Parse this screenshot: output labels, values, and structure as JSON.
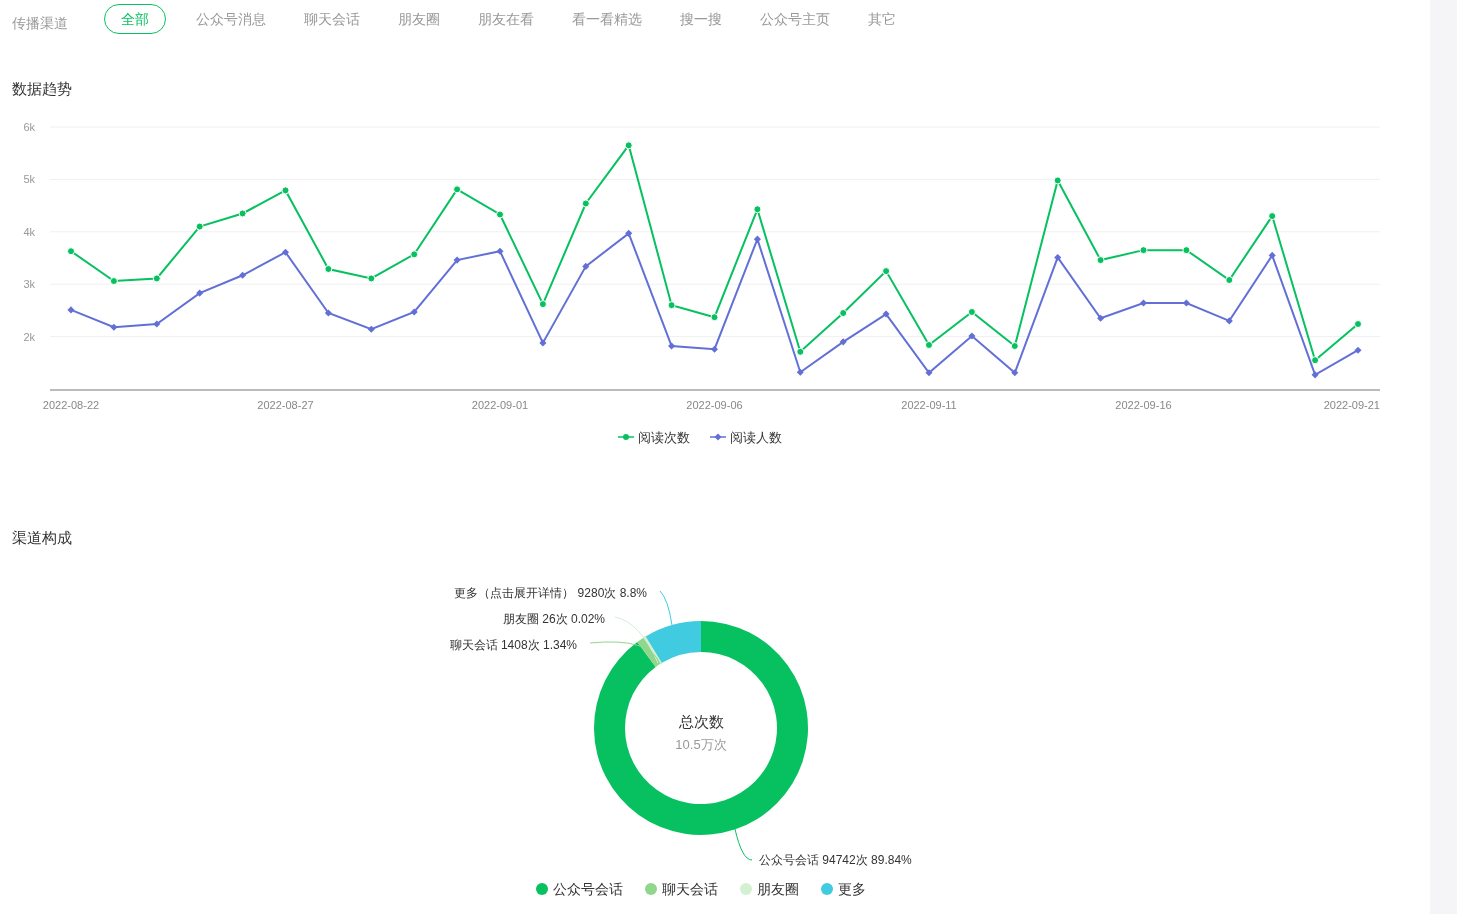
{
  "channel_filter": {
    "label": "传播渠道",
    "tabs": [
      {
        "label": "全部",
        "selected": true
      },
      {
        "label": "公众号消息",
        "selected": false
      },
      {
        "label": "聊天会话",
        "selected": false
      },
      {
        "label": "朋友圈",
        "selected": false
      },
      {
        "label": "朋友在看",
        "selected": false
      },
      {
        "label": "看一看精选",
        "selected": false
      },
      {
        "label": "搜一搜",
        "selected": false
      },
      {
        "label": "公众号主页",
        "selected": false
      },
      {
        "label": "其它",
        "selected": false
      }
    ]
  },
  "trend": {
    "title": "数据趋势",
    "chart_data": {
      "type": "line",
      "ylim": [
        1000,
        6000
      ],
      "grid": true,
      "yticks": [
        {
          "value": 2000,
          "label": "2k"
        },
        {
          "value": 3000,
          "label": "3k"
        },
        {
          "value": 4000,
          "label": "4k"
        },
        {
          "value": 5000,
          "label": "5k"
        },
        {
          "value": 6000,
          "label": "6k"
        }
      ],
      "categories": [
        "2022-08-22",
        null,
        null,
        null,
        null,
        "2022-08-27",
        null,
        null,
        null,
        null,
        "2022-09-01",
        null,
        null,
        null,
        null,
        "2022-09-06",
        null,
        null,
        null,
        null,
        "2022-09-11",
        null,
        null,
        null,
        null,
        "2022-09-16",
        null,
        null,
        null,
        null,
        "2022-09-21"
      ],
      "series": [
        {
          "name": "阅读次数",
          "color": "#07c160",
          "marker": "circle",
          "values": [
            3630,
            3060,
            3110,
            4100,
            4350,
            4790,
            3290,
            3110,
            3570,
            4810,
            4330,
            2620,
            4540,
            5650,
            2600,
            2370,
            4430,
            1710,
            2450,
            3250,
            1840,
            2470,
            1820,
            4980,
            3460,
            3650,
            3650,
            3080,
            4300,
            1550,
            2240
          ]
        },
        {
          "name": "阅读人数",
          "color": "#6270d6",
          "marker": "diamond",
          "values": [
            2510,
            2180,
            2240,
            2830,
            3170,
            3610,
            2450,
            2140,
            2470,
            3460,
            3630,
            1880,
            3340,
            3970,
            1820,
            1760,
            3860,
            1320,
            1900,
            2430,
            1310,
            2010,
            1310,
            3510,
            2350,
            2640,
            2640,
            2300,
            3550,
            1270,
            1740
          ]
        }
      ]
    }
  },
  "composition": {
    "title": "渠道构成",
    "center_title": "总次数",
    "center_value": "10.5万次",
    "chart_data": {
      "type": "donut",
      "categories": [
        "公众号会话",
        "聊天会话",
        "朋友圈",
        "更多"
      ],
      "series": [
        {
          "values": [
            89.84,
            1.34,
            0.02,
            8.8
          ]
        }
      ],
      "colors": [
        "#07c160",
        "#91d68d",
        "#d2f0d2",
        "#40cbe0"
      ]
    },
    "callouts": [
      "更多（点击展开详情） 9280次 8.8%",
      "朋友圈 26次 0.02%",
      "聊天会话 1408次 1.34%",
      "公众号会话 94742次 89.84%"
    ]
  }
}
